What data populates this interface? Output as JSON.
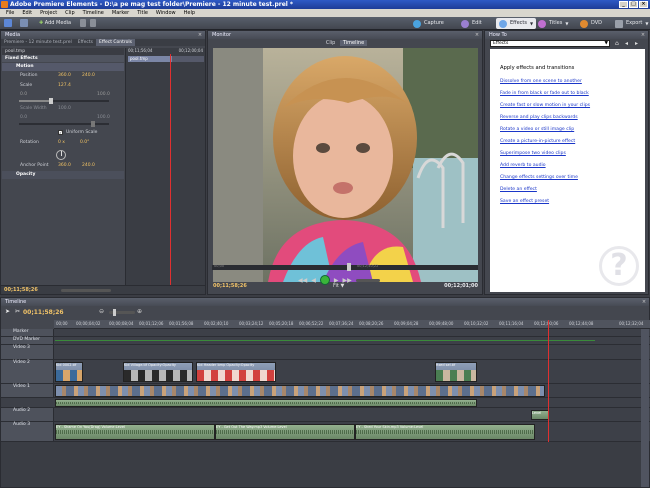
{
  "window": {
    "title": "Adobe Premiere Elements - D:\\a pe mag test folder\\Premiere - 12 minute test.prel *"
  },
  "menu": [
    "File",
    "Edit",
    "Project",
    "Clip",
    "Timeline",
    "Marker",
    "Title",
    "Window",
    "Help"
  ],
  "toolbar": {
    "add_media": "Add Media",
    "capture": "Capture",
    "edit": "Edit",
    "effects": "Effects",
    "titles": "Titles",
    "dvd": "DVD",
    "export": "Export"
  },
  "media_panel": {
    "title": "Media",
    "tabs": [
      "Premiere - 12 minute test.prel",
      "Effects",
      "Effect Controls"
    ],
    "clip": "pool.tmp",
    "fixed": "Fixed Effects",
    "rows": {
      "motion": "Motion",
      "position": "Position",
      "position_x": "360.0",
      "position_y": "240.0",
      "scale": "Scale",
      "scale_val": "127.4",
      "scale_min": "0.0",
      "scale_max": "100.0",
      "scale_w": "Scale Width",
      "scale_w_val": "100.0",
      "uniform": "Uniform Scale",
      "rotation": "Rotation",
      "rot_val": "0 x",
      "rot_deg": "0.0°",
      "anchor": "Anchor Point",
      "anchor_x": "360.0",
      "anchor_y": "240.0",
      "opacity": "Opacity"
    },
    "ruler_start": "00;11;56;04",
    "ruler_end": "00;12;00;04",
    "clip_label": "pool.tmp",
    "footer_tc": "00;11;58;26"
  },
  "monitor": {
    "title": "Monitor",
    "tab_clip": "Clip",
    "tab_timeline": "Timeline",
    "tc_current": "00;11;58;26",
    "fit": "Fit",
    "tc_duration": "00;12;01;00",
    "ruler_start": "00;00",
    "ruler_mid": "00;12;40;22"
  },
  "howto": {
    "title": "How To",
    "dropdown": "Effects",
    "heading": "Apply effects and transitions",
    "links": [
      "Dissolve from one scene to another",
      "Fade in from black or fade out to black",
      "Create fast or slow motion in your clips",
      "Reverse and play clips backwards",
      "Rotate a video or still image clip",
      "Create a picture-in-picture effect",
      "Superimpose two video clips",
      "Add reverb to audio",
      "Change effects settings over time",
      "Delete an effect",
      "Save an effect preset"
    ]
  },
  "timeline": {
    "title": "Timeline",
    "tc": "00;11;58;26",
    "ruler": [
      "00;00",
      "00;00;04;02",
      "00;00;08;04",
      "00;01;12;06",
      "00;01;56;08",
      "00;02;40;10",
      "00;03;24;12",
      "00;05;20;18",
      "00;06;52;22",
      "00;07;36;24",
      "00;08;20;26",
      "00;09;04;28",
      "00;09;48;00",
      "00;10;32;02",
      "00;11;16;04",
      "00;12;00;06",
      "00;12;44;08",
      "00;12;32;04"
    ],
    "tracks": {
      "marker": "Marker",
      "dvd": "DVD Marker",
      "v3": "Video 3",
      "v2": "Video 2",
      "v1": "Video 1",
      "a2": "Audio 2",
      "a3": "Audio 3"
    },
    "clips": {
      "v2a": "Kid 0002.tif",
      "v2b": "Kid Village.tif Opacity:Opacity",
      "v2c": "Kid Header bmp Opacity:Opacity",
      "v2d": "fixed sel.tif",
      "a3a": "EY - Shame On You(Drag) Volume:Level",
      "a3b": "EY - Get Out The Way.mp3 Volume:Level",
      "a3c": "EY - Shed Your Skin.mp3 Volume:Level",
      "a2a": "Level"
    }
  },
  "colors": {
    "accent": "#f1c368",
    "playhead": "#e03030",
    "link": "#1a36c8"
  }
}
